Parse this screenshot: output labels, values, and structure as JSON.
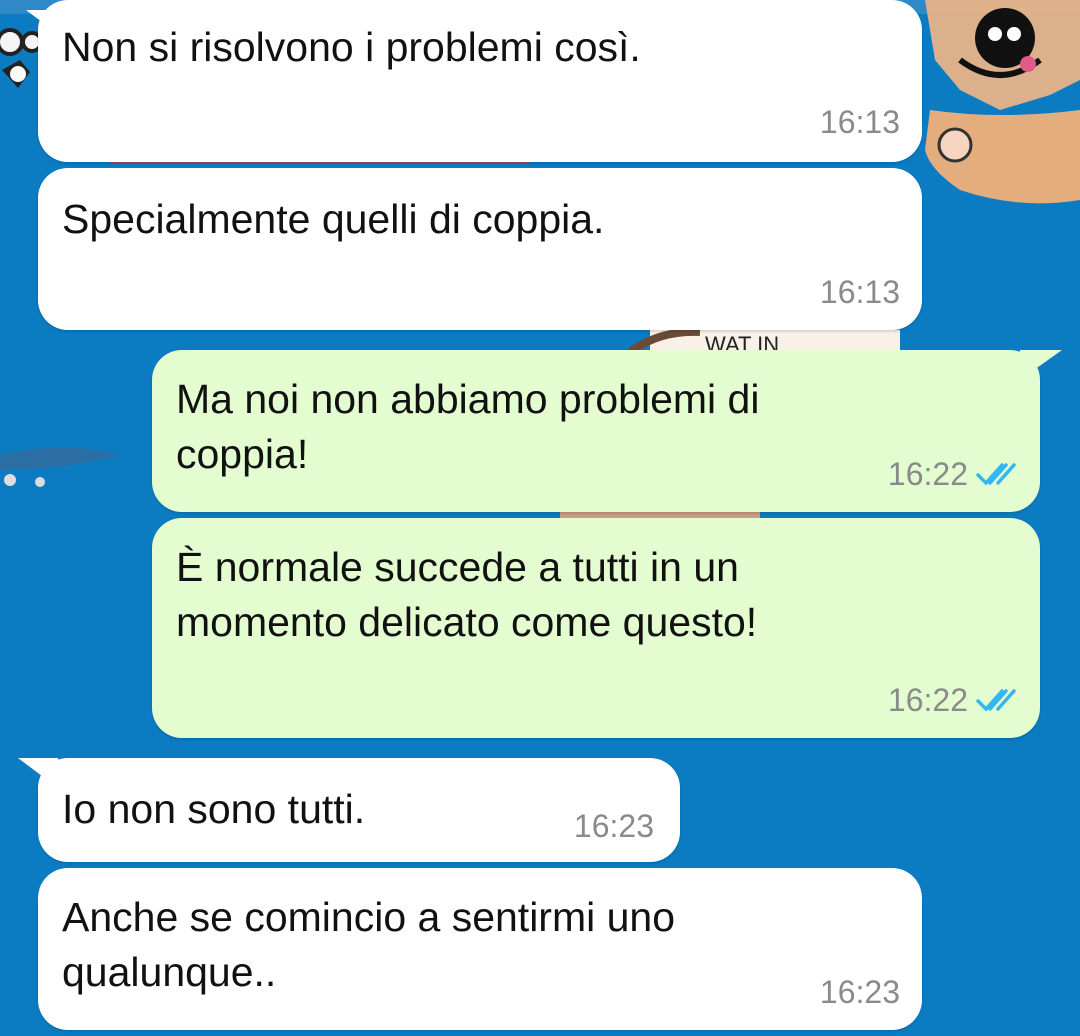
{
  "chat": {
    "messages": [
      {
        "text": "Non si risolvono i problemi così.",
        "time": "16:13",
        "direction": "incoming"
      },
      {
        "text": "Specialmente quelli di coppia.",
        "time": "16:13",
        "direction": "incoming"
      },
      {
        "text": "Ma noi non abbiamo problemi di\ncoppia!",
        "time": "16:22",
        "direction": "outgoing",
        "status": "read"
      },
      {
        "text": "È normale succede a tutti in un\nmomento delicato come questo!",
        "time": "16:22",
        "direction": "outgoing",
        "status": "read"
      },
      {
        "text": "Io non sono tutti.",
        "time": "16:23",
        "direction": "incoming"
      },
      {
        "text": "Anche se comincio a sentirmi uno\nqualunque..",
        "time": "16:23",
        "direction": "incoming"
      }
    ],
    "background_overlay_text": "WAT IN"
  },
  "colors": {
    "wallpaper": "#0b7cc2",
    "incoming_bubble": "#ffffff",
    "outgoing_bubble": "#e3fdd0",
    "time_text": "#8a8a8a",
    "read_tick": "#34b7f1"
  },
  "icons": {
    "read_receipt": "double-check-icon",
    "wallpaper_art": "cartoon-wallpaper"
  }
}
